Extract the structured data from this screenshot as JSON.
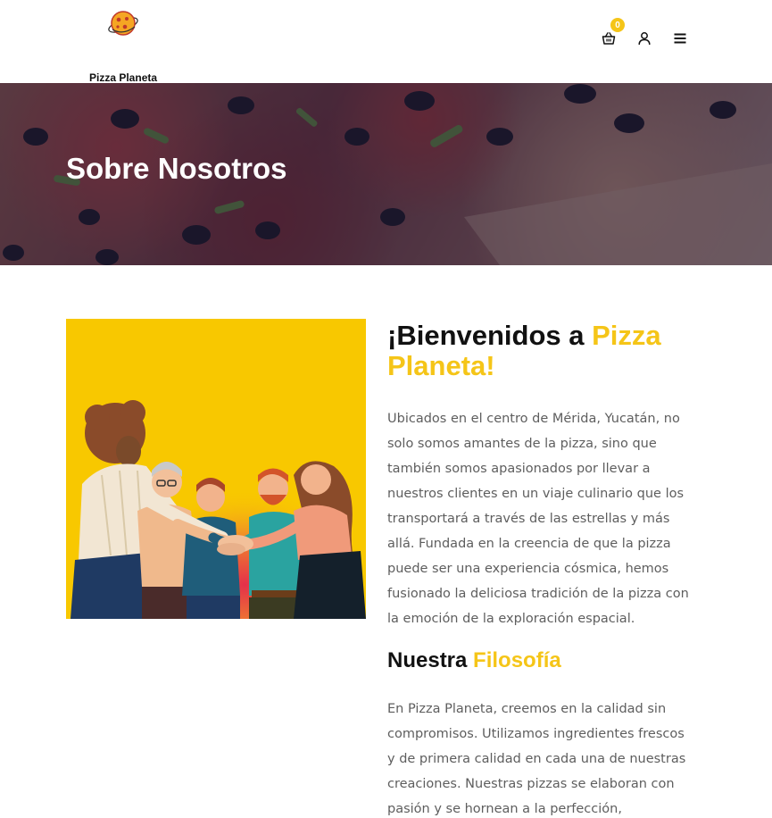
{
  "header": {
    "brand_name": "Pizza Planeta",
    "cart_count": "0",
    "icons": [
      "pizza-planet-logo",
      "basket-icon",
      "user-icon",
      "hamburger-menu-icon"
    ]
  },
  "hero": {
    "title": "Sobre Nosotros"
  },
  "about": {
    "welcome_prefix": "¡Bienvenidos a ",
    "welcome_highlight": "Pizza Planeta!",
    "intro": "Ubicados en el centro de Mérida, Yucatán, no solo somos amantes de la pizza, sino que también somos apasionados por llevar a nuestros clientes en un viaje culinario que los transportará a través de las estrellas y más allá. Fundada en la creencia de que la pizza puede ser una experiencia cósmica, hemos fusionado la deliciosa tradición de la pizza con la emoción de la exploración espacial.",
    "philosophy_prefix": "Nuestra ",
    "philosophy_highlight": "Filosofía",
    "philosophy_text": "En Pizza Planeta, creemos en la calidad sin compromisos. Utilizamos ingredientes frescos y de primera calidad en cada una de nuestras creaciones. Nuestras pizzas se elaboran con pasión y se hornean a la perfección,"
  },
  "colors": {
    "accent": "#f5c518",
    "illustration_bg": "#f8c800",
    "hero_overlay": "#1c183c"
  }
}
